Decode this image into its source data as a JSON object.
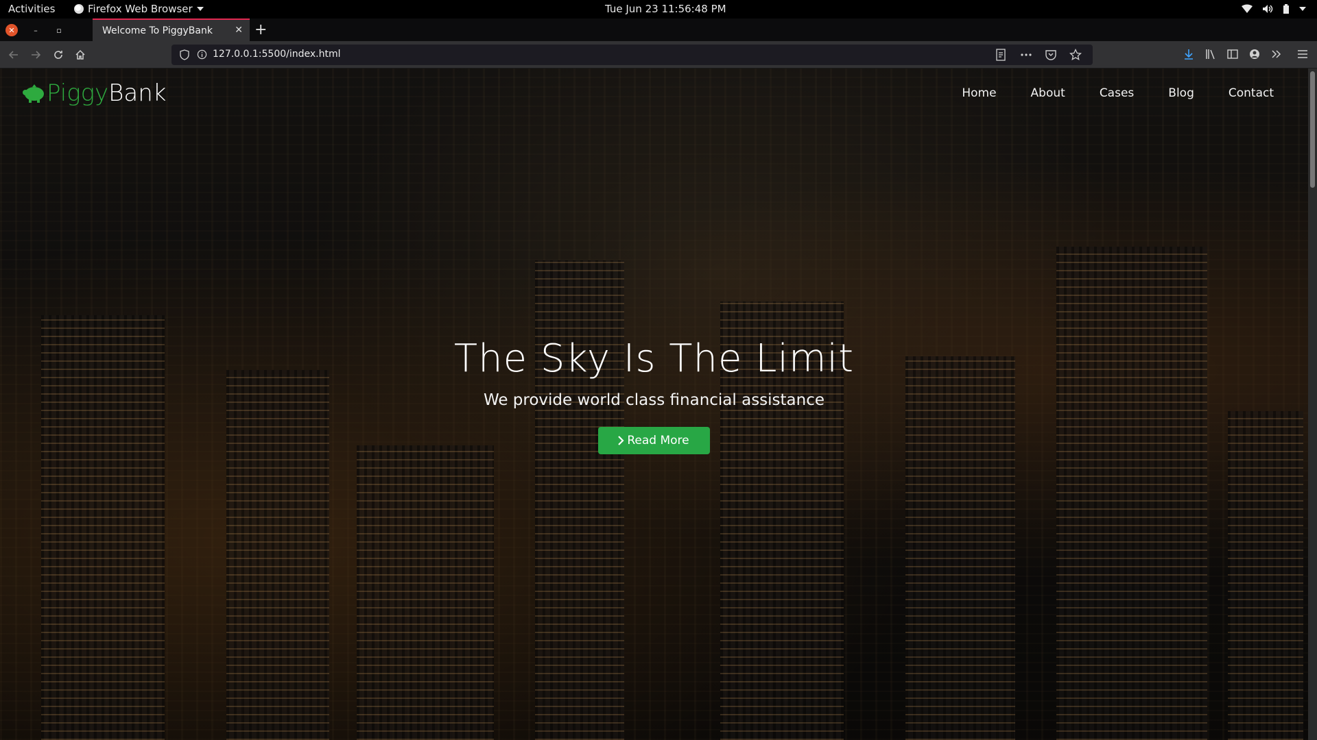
{
  "system_bar": {
    "activities_label": "Activities",
    "app_name": "Firefox Web Browser",
    "clock": "Tue Jun 23  11:56:48 PM"
  },
  "browser": {
    "tab_title": "Welcome To PiggyBank",
    "url": "127.0.0.1:5500/index.html",
    "icons": [
      "back-icon",
      "forward-icon",
      "reload-icon",
      "home-icon",
      "shield-icon",
      "info-icon",
      "reader-view-icon",
      "page-actions-icon",
      "pocket-icon",
      "bookmark-star-icon",
      "downloads-icon",
      "library-icon",
      "sidebar-icon",
      "account-icon",
      "overflow-icon",
      "hamburger-menu-icon"
    ]
  },
  "site": {
    "logo_part1": "Piggy",
    "logo_part2": "Bank",
    "nav": {
      "home": "Home",
      "about": "About",
      "cases": "Cases",
      "blog": "Blog",
      "contact": "Contact"
    },
    "hero": {
      "title": "The Sky Is The Limit",
      "subtitle": "We provide world class financial assistance",
      "button_label": "Read More"
    }
  },
  "colors": {
    "brand_green": "#2eaa3f",
    "button_green": "#28a745",
    "tab_accent": "#e22850"
  }
}
